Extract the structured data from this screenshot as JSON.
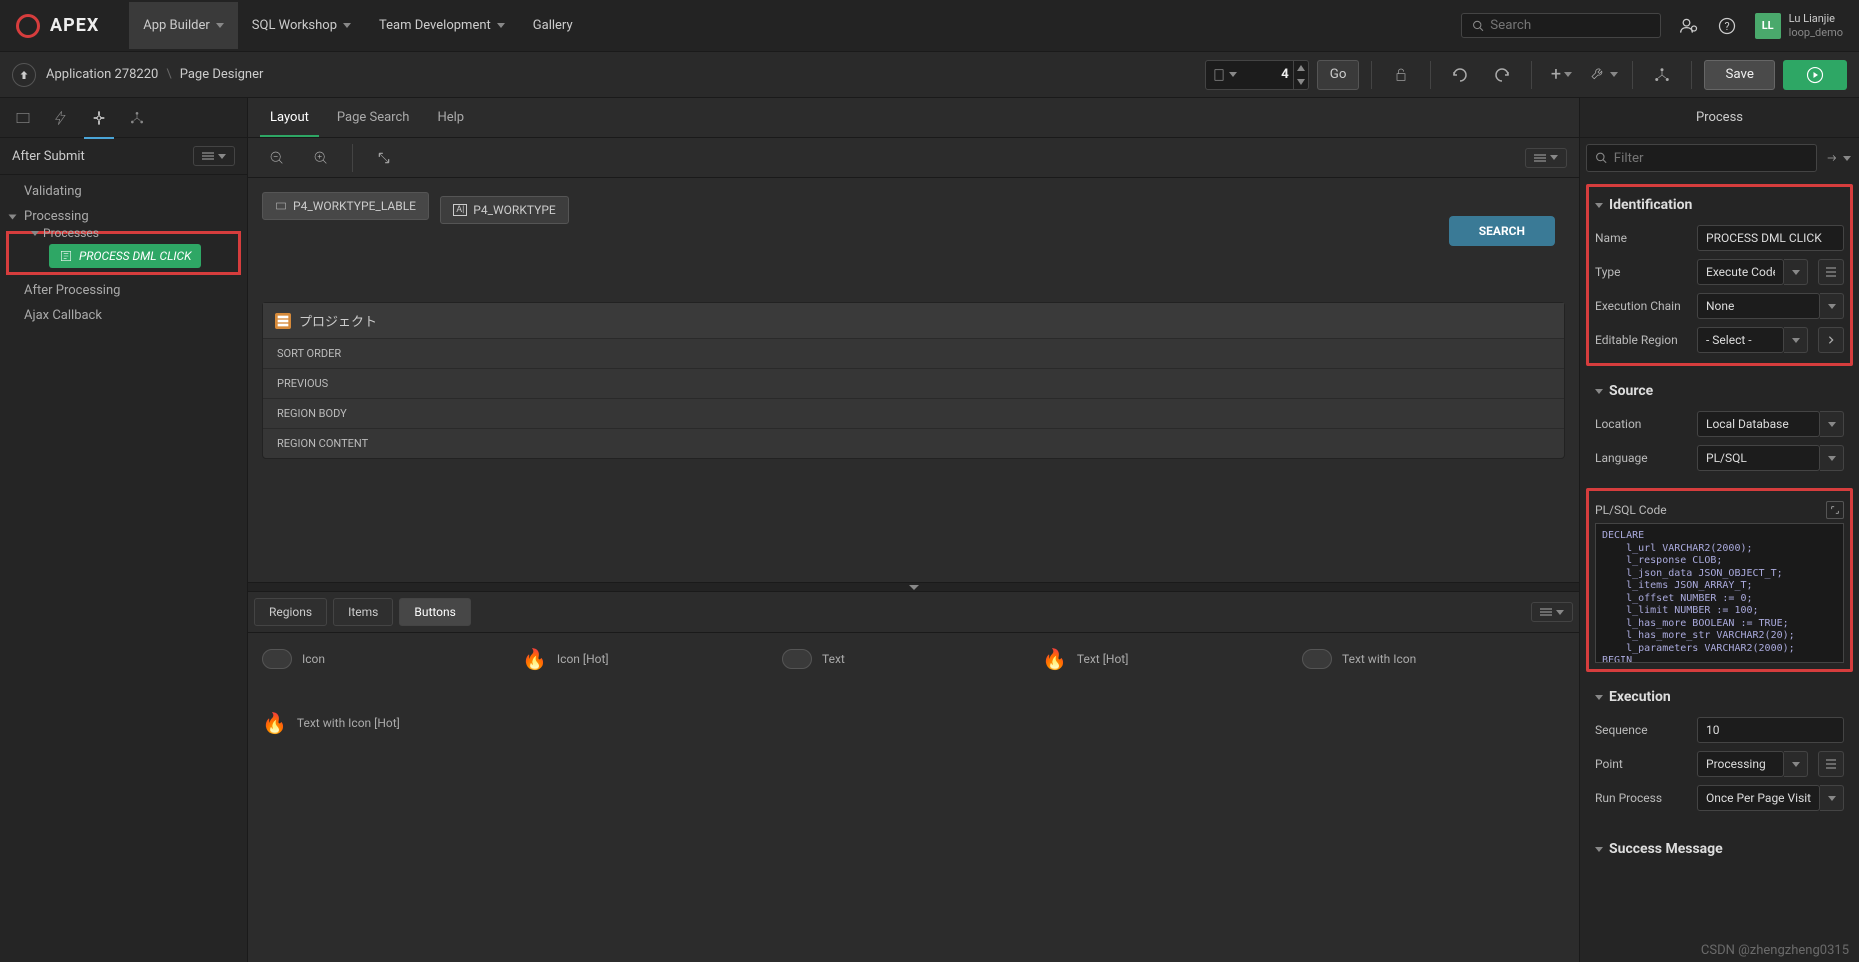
{
  "topbar": {
    "brand": "APEX",
    "nav": [
      "App Builder",
      "SQL Workshop",
      "Team Development",
      "Gallery"
    ],
    "search_placeholder": "Search",
    "user_initials": "LL",
    "user_name": "Lu Lianjie",
    "workspace": "loop_demo"
  },
  "breadcrumb": {
    "app": "Application 278220",
    "page": "Page Designer",
    "page_num": "4",
    "go": "Go",
    "save": "Save"
  },
  "left": {
    "title": "After Submit",
    "items": [
      "After Submit",
      "Validating",
      "Processing",
      "Processes"
    ],
    "process_name": "PROCESS DML CLICK",
    "after_processing": "After Processing",
    "ajax": "Ajax Callback"
  },
  "center": {
    "tabs": [
      "Layout",
      "Page Search",
      "Help"
    ],
    "chips": {
      "label": "P4_WORKTYPE_LABLE",
      "field": "P4_WORKTYPE"
    },
    "search_btn": "SEARCH",
    "region_title": "プロジェクト",
    "region_rows": [
      "SORT ORDER",
      "PREVIOUS",
      "REGION BODY",
      "REGION CONTENT"
    ],
    "gallery_tabs": [
      "Regions",
      "Items",
      "Buttons"
    ],
    "gallery_items": [
      "Icon",
      "Icon [Hot]",
      "Text",
      "Text [Hot]",
      "Text with Icon",
      "Text with Icon [Hot]"
    ]
  },
  "right": {
    "title": "Process",
    "filter_placeholder": "Filter",
    "identification": {
      "title": "Identification",
      "name_label": "Name",
      "name_value": "PROCESS DML CLICK",
      "type_label": "Type",
      "type_value": "Execute Code",
      "chain_label": "Execution Chain",
      "chain_value": "None",
      "region_label": "Editable Region",
      "region_value": "- Select -"
    },
    "source": {
      "title": "Source",
      "location_label": "Location",
      "location_value": "Local Database",
      "language_label": "Language",
      "language_value": "PL/SQL",
      "code_label": "PL/SQL Code",
      "code_lines": [
        "DECLARE",
        "    l_url VARCHAR2(2000);",
        "    l_response CLOB;",
        "    l_json_data JSON_OBJECT_T;",
        "    l_items JSON_ARRAY_T;",
        "    l_offset NUMBER := 0;",
        "    l_limit NUMBER := 100;",
        "    l_has_more BOOLEAN := TRUE;",
        "    l_has_more_str VARCHAR2(20);",
        "    l_parameters VARCHAR2(2000);",
        "BEGIN"
      ]
    },
    "execution": {
      "title": "Execution",
      "seq_label": "Sequence",
      "seq_value": "10",
      "point_label": "Point",
      "point_value": "Processing",
      "run_label": "Run Process",
      "run_value": "Once Per Page Visit (default"
    },
    "success": {
      "title": "Success Message"
    }
  },
  "watermark": "CSDN @zhengzheng0315"
}
